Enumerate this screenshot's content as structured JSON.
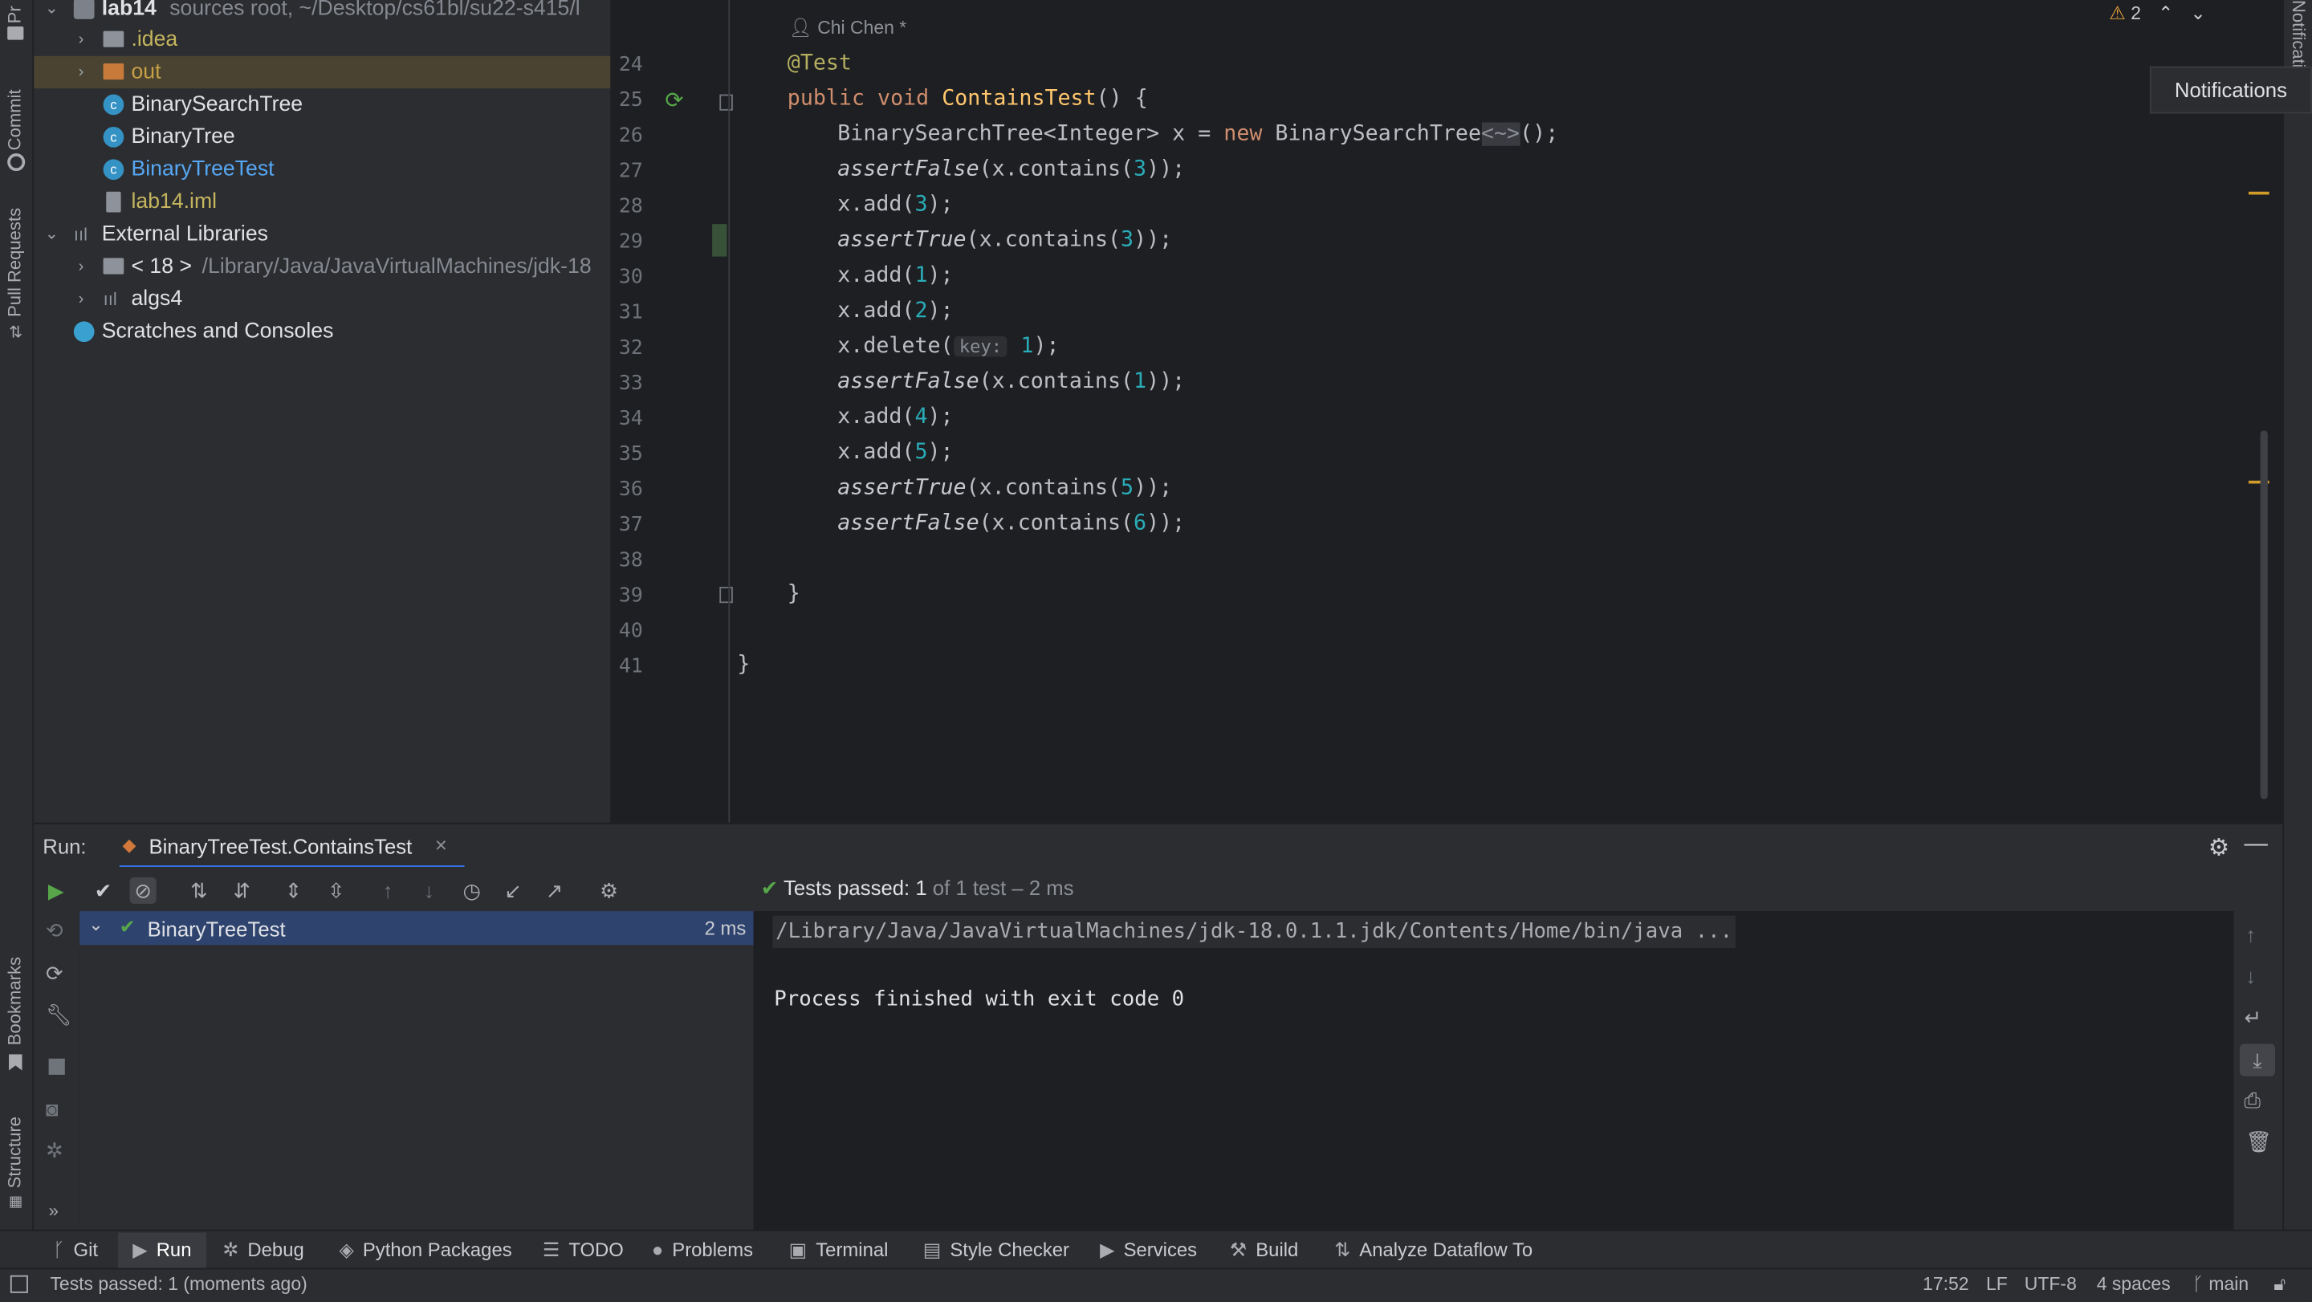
{
  "project": {
    "root_name": "lab14",
    "root_path": "sources root, ~/Desktop/cs61bl/su22-s415/l",
    "items": [
      {
        "label": ".idea",
        "type": "folder",
        "color": "#c5b55e"
      },
      {
        "label": "out",
        "type": "folder-excluded",
        "color": "#c5a045"
      },
      {
        "label": "BinarySearchTree",
        "type": "java-class",
        "color": "#dfe1e5"
      },
      {
        "label": "BinaryTree",
        "type": "java-class",
        "color": "#dfe1e5"
      },
      {
        "label": "BinaryTreeTest",
        "type": "java-test-class",
        "color": "#56a8f5"
      },
      {
        "label": "lab14.iml",
        "type": "iml-file",
        "color": "#c5b55e"
      }
    ],
    "external_libraries": "External Libraries",
    "jdk_label": "< 18 >",
    "jdk_path": "/Library/Java/JavaVirtualMachines/jdk-18",
    "algs4": "algs4",
    "scratches": "Scratches and Consoles"
  },
  "left_tabs": {
    "project": "Pr",
    "commit": "Commit",
    "pull_requests": "Pull Requests",
    "bookmarks": "Bookmarks",
    "structure": "Structure"
  },
  "editor": {
    "author": "Chi Chen *",
    "warning_count": "2",
    "line_numbers": [
      "24",
      "25",
      "26",
      "27",
      "28",
      "29",
      "30",
      "31",
      "32",
      "33",
      "34",
      "35",
      "36",
      "37",
      "38",
      "39",
      "40",
      "41"
    ],
    "hint_key": "key:",
    "code": {
      "l24": "@Test",
      "l25_kw": "public void ",
      "l25_fn": "ContainsTest",
      "l25_rest": "() {",
      "l26_a": "BinarySearchTree<Integer> x = ",
      "l26_new": "new ",
      "l26_b": "BinarySearchTree",
      "l26_fold": "<~>",
      "l26_c": "();",
      "l27": "assertFalse",
      "l27_a": "(x.contains(",
      "l27_n": "3",
      "l27_b": "));",
      "l28_a": "x.add(",
      "l28_n": "3",
      "l28_b": ");",
      "l29": "assertTrue",
      "l29_a": "(x.contains(",
      "l29_n": "3",
      "l29_b": "));",
      "l30_a": "x.add(",
      "l30_n": "1",
      "l30_b": ");",
      "l31_a": "x.add(",
      "l31_n": "2",
      "l31_b": ");",
      "l32_a": "x.delete(",
      "l32_n": "1",
      "l32_b": ");",
      "l33": "assertFalse",
      "l33_a": "(x.contains(",
      "l33_n": "1",
      "l33_b": "));",
      "l34_a": "x.add(",
      "l34_n": "4",
      "l34_b": ");",
      "l35_a": "x.add(",
      "l35_n": "5",
      "l35_b": ");",
      "l36": "assertTrue",
      "l36_a": "(x.contains(",
      "l36_n": "5",
      "l36_b": "));",
      "l37": "assertFalse",
      "l37_a": "(x.contains(",
      "l37_n": "6",
      "l37_b": "));",
      "l39": "}",
      "l41": "}"
    }
  },
  "notifications": {
    "popup": "Notifications",
    "strip": "Notifications"
  },
  "run": {
    "label": "Run:",
    "tab": "BinaryTreeTest.ContainsTest",
    "status_bold": "Tests passed: 1",
    "status_rest": " of 1 test – 2 ms",
    "tree_item": "BinaryTreeTest",
    "tree_time": "2 ms",
    "console_line1": "/Library/Java/JavaVirtualMachines/jdk-18.0.1.1.jdk/Contents/Home/bin/java ...",
    "console_line2": "Process finished with exit code 0"
  },
  "toolwindows": [
    {
      "label": "Git",
      "icon": "git-branch-icon"
    },
    {
      "label": "Run",
      "icon": "run-icon"
    },
    {
      "label": "Debug",
      "icon": "bug-icon"
    },
    {
      "label": "Python Packages",
      "icon": "packages-icon"
    },
    {
      "label": "TODO",
      "icon": "list-icon"
    },
    {
      "label": "Problems",
      "icon": "info-icon"
    },
    {
      "label": "Terminal",
      "icon": "terminal-icon"
    },
    {
      "label": "Style Checker",
      "icon": "checker-icon"
    },
    {
      "label": "Services",
      "icon": "services-icon"
    },
    {
      "label": "Build",
      "icon": "hammer-icon"
    },
    {
      "label": "Analyze Dataflow To",
      "icon": "dataflow-icon"
    }
  ],
  "status": {
    "message": "Tests passed: 1 (moments ago)",
    "time": "17:52",
    "line_sep": "LF",
    "encoding": "UTF-8",
    "indent": "4 spaces",
    "branch": "main"
  }
}
